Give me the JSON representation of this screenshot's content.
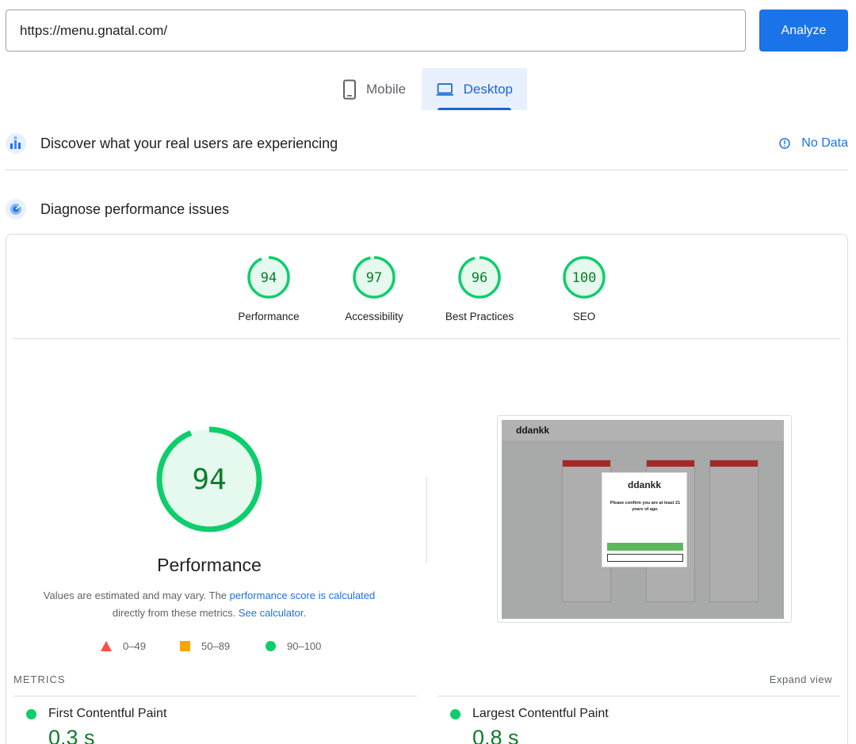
{
  "url_bar": {
    "value": "https://menu.gnatal.com/"
  },
  "analyze_label": "Analyze",
  "tabs": [
    {
      "label": "Mobile",
      "selected": false
    },
    {
      "label": "Desktop",
      "selected": true
    }
  ],
  "field_data": {
    "title": "Discover what your real users are experiencing",
    "no_data_label": "No Data"
  },
  "lab": {
    "title": "Diagnose performance issues",
    "categories": [
      {
        "score": "94",
        "label": "Performance"
      },
      {
        "score": "97",
        "label": "Accessibility"
      },
      {
        "score": "96",
        "label": "Best Practices"
      },
      {
        "score": "100",
        "label": "SEO"
      }
    ],
    "main_gauge": {
      "score": "94",
      "label": "Performance"
    },
    "description": {
      "prefix": "Values are estimated and may vary. The",
      "link1": "performance score is calculated",
      "middle": "directly from these metrics.",
      "link2": "See calculator",
      "suffix": "."
    },
    "legend": [
      {
        "range": "0–49",
        "color": "#ff4e42"
      },
      {
        "range": "50–89",
        "color": "#ffa400"
      },
      {
        "range": "90–100",
        "color": "#0cce6b"
      }
    ]
  },
  "screenshot": {
    "logo": "ddankk",
    "modal_logo": "ddankk",
    "modal_title": "Please confirm you are at least 21 years of age."
  },
  "metrics": {
    "title": "METRICS",
    "expand_label": "Expand view",
    "items": [
      {
        "name": "First Contentful Paint",
        "value": "0.3 s"
      },
      {
        "name": "Largest Contentful Paint",
        "value": "0.8 s"
      }
    ]
  },
  "colors": {
    "accent": "#1a73e8",
    "pass": "#0cce6b",
    "pass_text": "#0c7d2a"
  }
}
